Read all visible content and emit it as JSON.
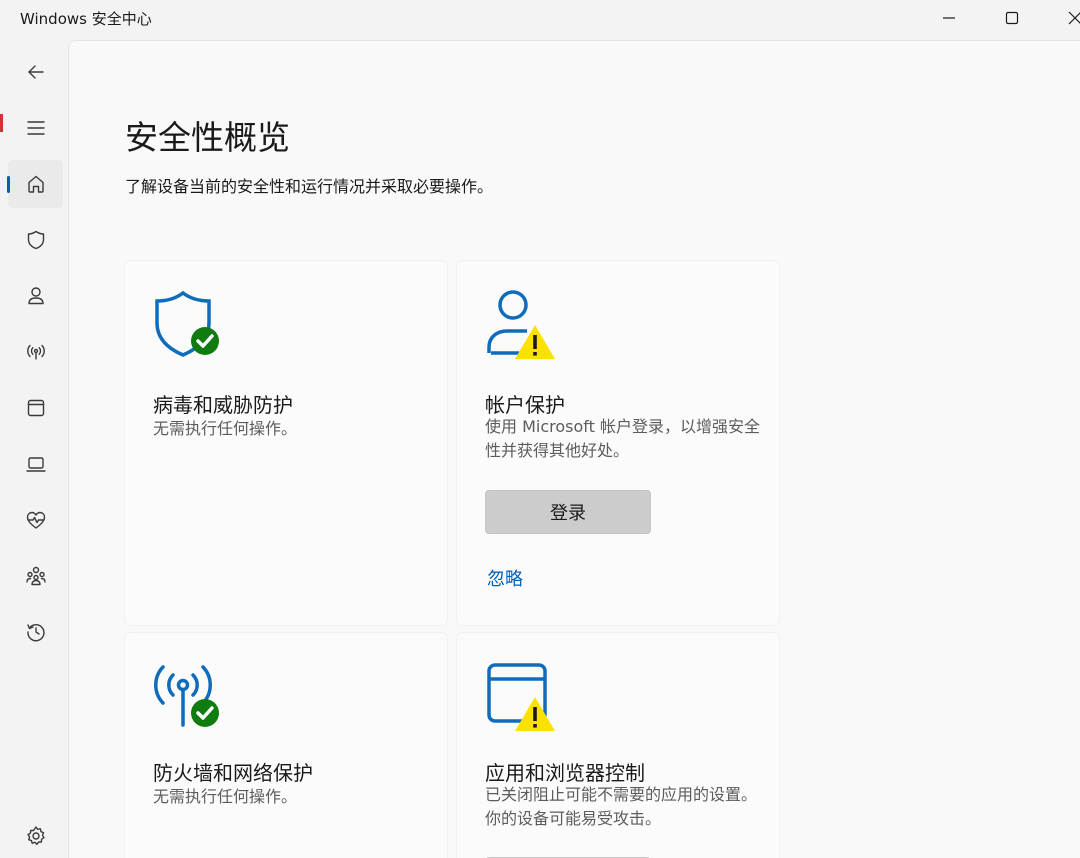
{
  "window": {
    "title": "Windows 安全中心",
    "minimize": "minimize-icon",
    "maximize": "maximize-icon",
    "close": "close-icon"
  },
  "sidebar": {
    "items": [
      {
        "name": "back",
        "icon": "back-arrow-icon"
      },
      {
        "name": "menu",
        "icon": "hamburger-menu-icon"
      },
      {
        "name": "home",
        "icon": "home-icon",
        "selected": true
      },
      {
        "name": "virus-protection",
        "icon": "shield-icon"
      },
      {
        "name": "account-protection",
        "icon": "person-icon"
      },
      {
        "name": "firewall",
        "icon": "antenna-icon"
      },
      {
        "name": "app-browser",
        "icon": "browser-window-icon"
      },
      {
        "name": "device-security",
        "icon": "laptop-icon"
      },
      {
        "name": "device-health",
        "icon": "heart-pulse-icon"
      },
      {
        "name": "family-options",
        "icon": "family-icon"
      },
      {
        "name": "protection-history",
        "icon": "history-icon"
      }
    ],
    "settings": {
      "icon": "gear-icon"
    }
  },
  "main": {
    "title": "安全性概览",
    "subtitle": "了解设备当前的安全性和运行情况并采取必要操作。",
    "cards": [
      {
        "title": "病毒和威胁防护",
        "desc": "无需执行任何操作。",
        "icon": "shield-check-icon",
        "status": "ok"
      },
      {
        "title": "帐户保护",
        "desc": "使用 Microsoft 帐户登录，以增强安全性并获得其他好处。",
        "icon": "person-warning-icon",
        "status": "warning",
        "button": "登录",
        "link": "忽略"
      },
      {
        "title": "防火墙和网络保护",
        "desc": "无需执行任何操作。",
        "icon": "antenna-check-icon",
        "status": "ok"
      },
      {
        "title": "应用和浏览器控制",
        "desc": "已关闭阻止可能不需要的应用的设置。你的设备可能易受攻击。",
        "icon": "browser-warning-icon",
        "status": "warning"
      }
    ]
  },
  "colors": {
    "accent": "#005fb8",
    "icon_blue": "#0f6cbd",
    "ok_green": "#107c10",
    "warning_yellow": "#fce100"
  }
}
